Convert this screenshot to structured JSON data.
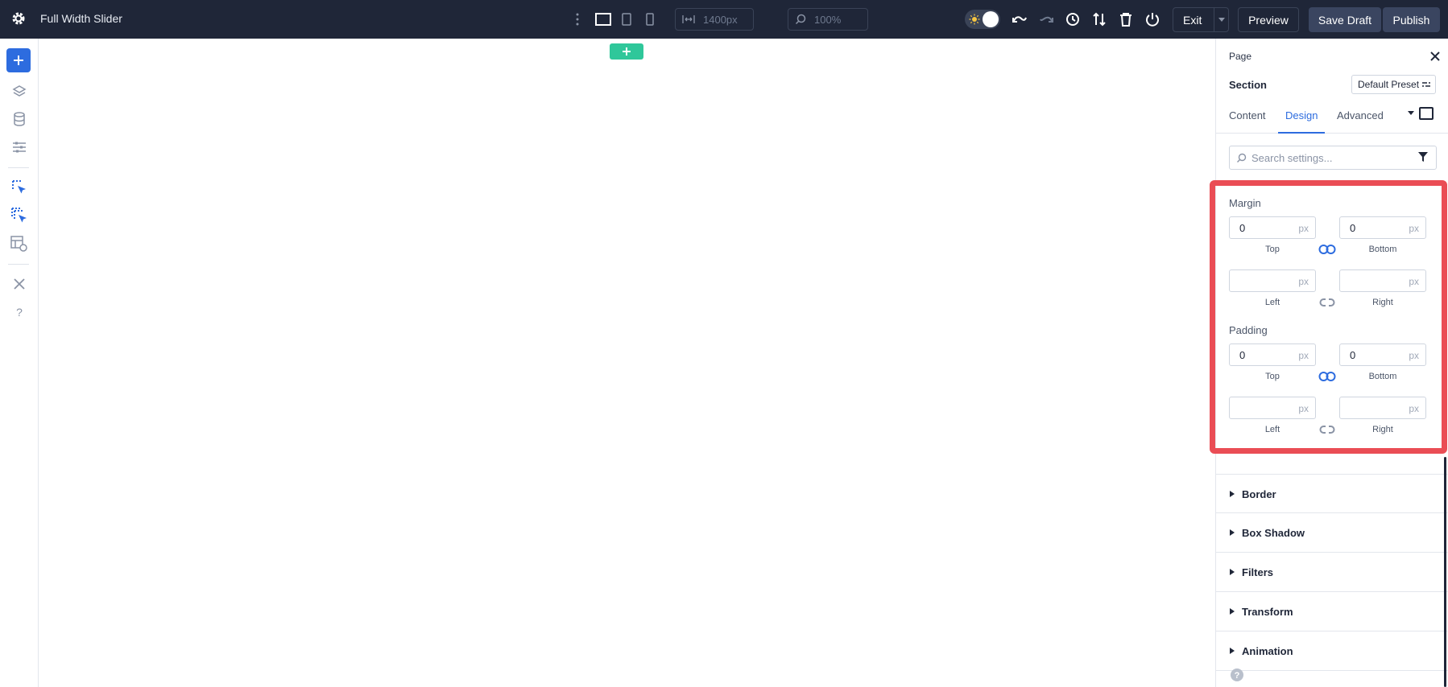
{
  "app": {
    "title": "Full Width Slider"
  },
  "toolbar": {
    "width_value": "1400px",
    "zoom_value": "100%",
    "exit_label": "Exit",
    "preview_label": "Preview",
    "save_draft_label": "Save Draft",
    "publish_label": "Publish"
  },
  "panel": {
    "breadcrumb": "Page",
    "section_title": "Section",
    "preset_label": "Default Preset",
    "tabs": [
      {
        "label": "Content"
      },
      {
        "label": "Design"
      },
      {
        "label": "Advanced"
      }
    ],
    "active_tab": "Design",
    "search_placeholder": "Search settings...",
    "margin": {
      "label": "Margin",
      "top": {
        "value": "0",
        "unit": "px",
        "label": "Top"
      },
      "bottom": {
        "value": "0",
        "unit": "px",
        "label": "Bottom"
      },
      "left": {
        "value": "",
        "unit": "px",
        "label": "Left"
      },
      "right": {
        "value": "",
        "unit": "px",
        "label": "Right"
      }
    },
    "padding": {
      "label": "Padding",
      "top": {
        "value": "0",
        "unit": "px",
        "label": "Top"
      },
      "bottom": {
        "value": "0",
        "unit": "px",
        "label": "Bottom"
      },
      "left": {
        "value": "",
        "unit": "px",
        "label": "Left"
      },
      "right": {
        "value": "",
        "unit": "px",
        "label": "Right"
      }
    },
    "accordions": [
      {
        "label": "Border"
      },
      {
        "label": "Box Shadow"
      },
      {
        "label": "Filters"
      },
      {
        "label": "Transform"
      },
      {
        "label": "Animation"
      }
    ]
  },
  "colors": {
    "topbar_bg": "#1f2638",
    "accent_blue": "#2d6cdf",
    "add_section_green": "#2fc79a",
    "highlight_red": "#ea4d55"
  }
}
